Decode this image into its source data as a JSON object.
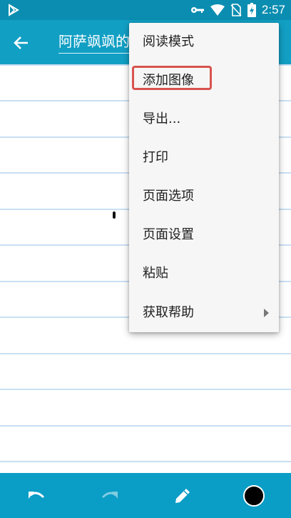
{
  "status": {
    "time": "2:57",
    "icons": [
      "play-store-notification-icon",
      "key-icon",
      "wifi-icon",
      "no-sim-icon",
      "battery-charging-icon"
    ]
  },
  "toolbar": {
    "back_icon": "arrow-back-icon",
    "title": "阿萨飒飒的"
  },
  "menu": {
    "items": [
      {
        "label": "阅读模式"
      },
      {
        "label": "添加图像"
      },
      {
        "label": "导出..."
      },
      {
        "label": "打印"
      },
      {
        "label": "页面选项"
      },
      {
        "label": "页面设置"
      },
      {
        "label": "粘贴"
      },
      {
        "label": "获取帮助",
        "has_submenu": true
      }
    ]
  },
  "bottom_bar": {
    "tools": [
      "undo-icon",
      "redo-icon",
      "pen-icon",
      "color-swatch"
    ],
    "accent_color": "#0a9dc6",
    "pen_color": "#000000"
  },
  "colors": {
    "status_bar": "#0a8db0",
    "app_bar": "#129fc4",
    "rule_lines": "#c9dff3",
    "highlight": "#d9534f"
  }
}
